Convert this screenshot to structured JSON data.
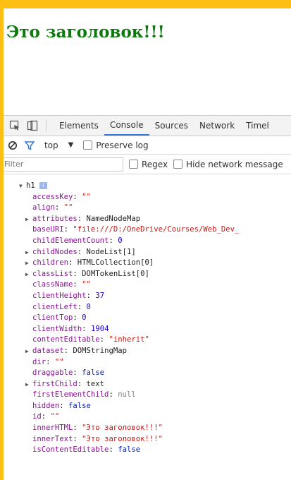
{
  "page": {
    "heading": "Это заголовок!!!"
  },
  "devtools": {
    "tabs": [
      "Elements",
      "Console",
      "Sources",
      "Network",
      "Timel"
    ],
    "active_tab": "Console",
    "context": "top",
    "preserve_log": "Preserve log",
    "filter_placeholder": "Filter",
    "regex": "Regex",
    "hide_network": "Hide network message"
  },
  "tree": {
    "root_label": "h1",
    "info_badge": "i",
    "properties": [
      {
        "key": "accessKey",
        "value": "\"\"",
        "type": "str",
        "expandable": false
      },
      {
        "key": "align",
        "value": "\"\"",
        "type": "str",
        "expandable": false
      },
      {
        "key": "attributes",
        "value": "NamedNodeMap",
        "type": "obj",
        "expandable": true
      },
      {
        "key": "baseURI",
        "value": "\"file:///D:/OneDrive/Courses/Web_Dev_",
        "type": "str",
        "expandable": false
      },
      {
        "key": "childElementCount",
        "value": "0",
        "type": "num",
        "expandable": false
      },
      {
        "key": "childNodes",
        "value": "NodeList[1]",
        "type": "obj",
        "expandable": true
      },
      {
        "key": "children",
        "value": "HTMLCollection[0]",
        "type": "obj",
        "expandable": true
      },
      {
        "key": "classList",
        "value": "DOMTokenList[0]",
        "type": "obj",
        "expandable": true
      },
      {
        "key": "className",
        "value": "\"\"",
        "type": "str",
        "expandable": false
      },
      {
        "key": "clientHeight",
        "value": "37",
        "type": "num",
        "expandable": false
      },
      {
        "key": "clientLeft",
        "value": "0",
        "type": "num",
        "expandable": false
      },
      {
        "key": "clientTop",
        "value": "0",
        "type": "num",
        "expandable": false
      },
      {
        "key": "clientWidth",
        "value": "1904",
        "type": "num",
        "expandable": false
      },
      {
        "key": "contentEditable",
        "value": "\"inherit\"",
        "type": "str",
        "expandable": false
      },
      {
        "key": "dataset",
        "value": "DOMStringMap",
        "type": "obj",
        "expandable": true
      },
      {
        "key": "dir",
        "value": "\"\"",
        "type": "str",
        "expandable": false
      },
      {
        "key": "draggable",
        "value": "false",
        "type": "kw",
        "expandable": false
      },
      {
        "key": "firstChild",
        "value": "text",
        "type": "obj",
        "expandable": true
      },
      {
        "key": "firstElementChild",
        "value": "null",
        "type": "nul",
        "expandable": false
      },
      {
        "key": "hidden",
        "value": "false",
        "type": "kw",
        "expandable": false
      },
      {
        "key": "id",
        "value": "\"\"",
        "type": "str",
        "expandable": false
      },
      {
        "key": "innerHTML",
        "value": "\"Это заголовок!!!\"",
        "type": "str",
        "expandable": false
      },
      {
        "key": "innerText",
        "value": "\"Это заголовок!!!\"",
        "type": "str",
        "expandable": false
      },
      {
        "key": "isContentEditable",
        "value": "false",
        "type": "kw",
        "expandable": false
      }
    ]
  },
  "colors": {
    "border_accent": "#fdbf14",
    "heading": "#0e7a0e",
    "active_tab_underline": "#3879d9"
  }
}
